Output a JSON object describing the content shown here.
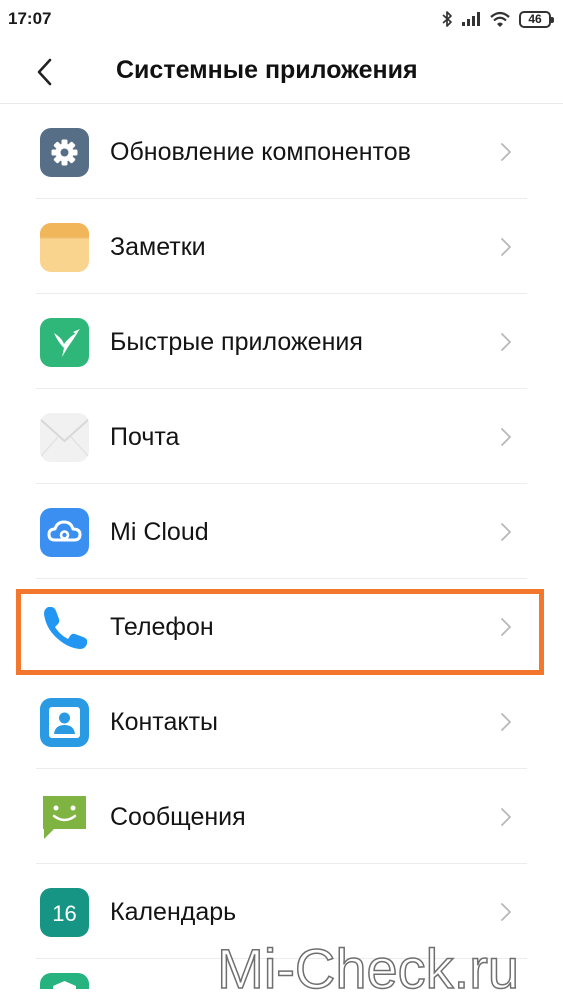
{
  "status_bar": {
    "time": "17:07",
    "battery": "46",
    "icons": [
      "bluetooth-icon",
      "signal-icon",
      "wifi-icon",
      "battery-icon"
    ]
  },
  "header": {
    "title": "Системные приложения",
    "back_icon": "chevron-left-icon"
  },
  "items": [
    {
      "label": "Обновление компонентов",
      "icon": "gear-icon",
      "icon_color": "#566f87"
    },
    {
      "label": "Заметки",
      "icon": "notes-icon",
      "icon_color": "#f6c976"
    },
    {
      "label": "Быстрые приложения",
      "icon": "hummingbird-icon",
      "icon_color": "#2fb779"
    },
    {
      "label": "Почта",
      "icon": "envelope-icon",
      "icon_color": "#eeeeee"
    },
    {
      "label": "Mi Cloud",
      "icon": "cloud-icon",
      "icon_color": "#3b8ff0"
    },
    {
      "label": "Телефон",
      "icon": "phone-icon",
      "icon_color": "#2196f3"
    },
    {
      "label": "Контакты",
      "icon": "contact-icon",
      "icon_color": "#2a9be2"
    },
    {
      "label": "Сообщения",
      "icon": "message-icon",
      "icon_color": "#7fb342"
    },
    {
      "label": "Календарь",
      "icon": "calendar-icon",
      "icon_color": "#169484",
      "icon_text": "16"
    }
  ],
  "highlight_color": "#f3782d",
  "watermark": "Mi-Check.ru"
}
